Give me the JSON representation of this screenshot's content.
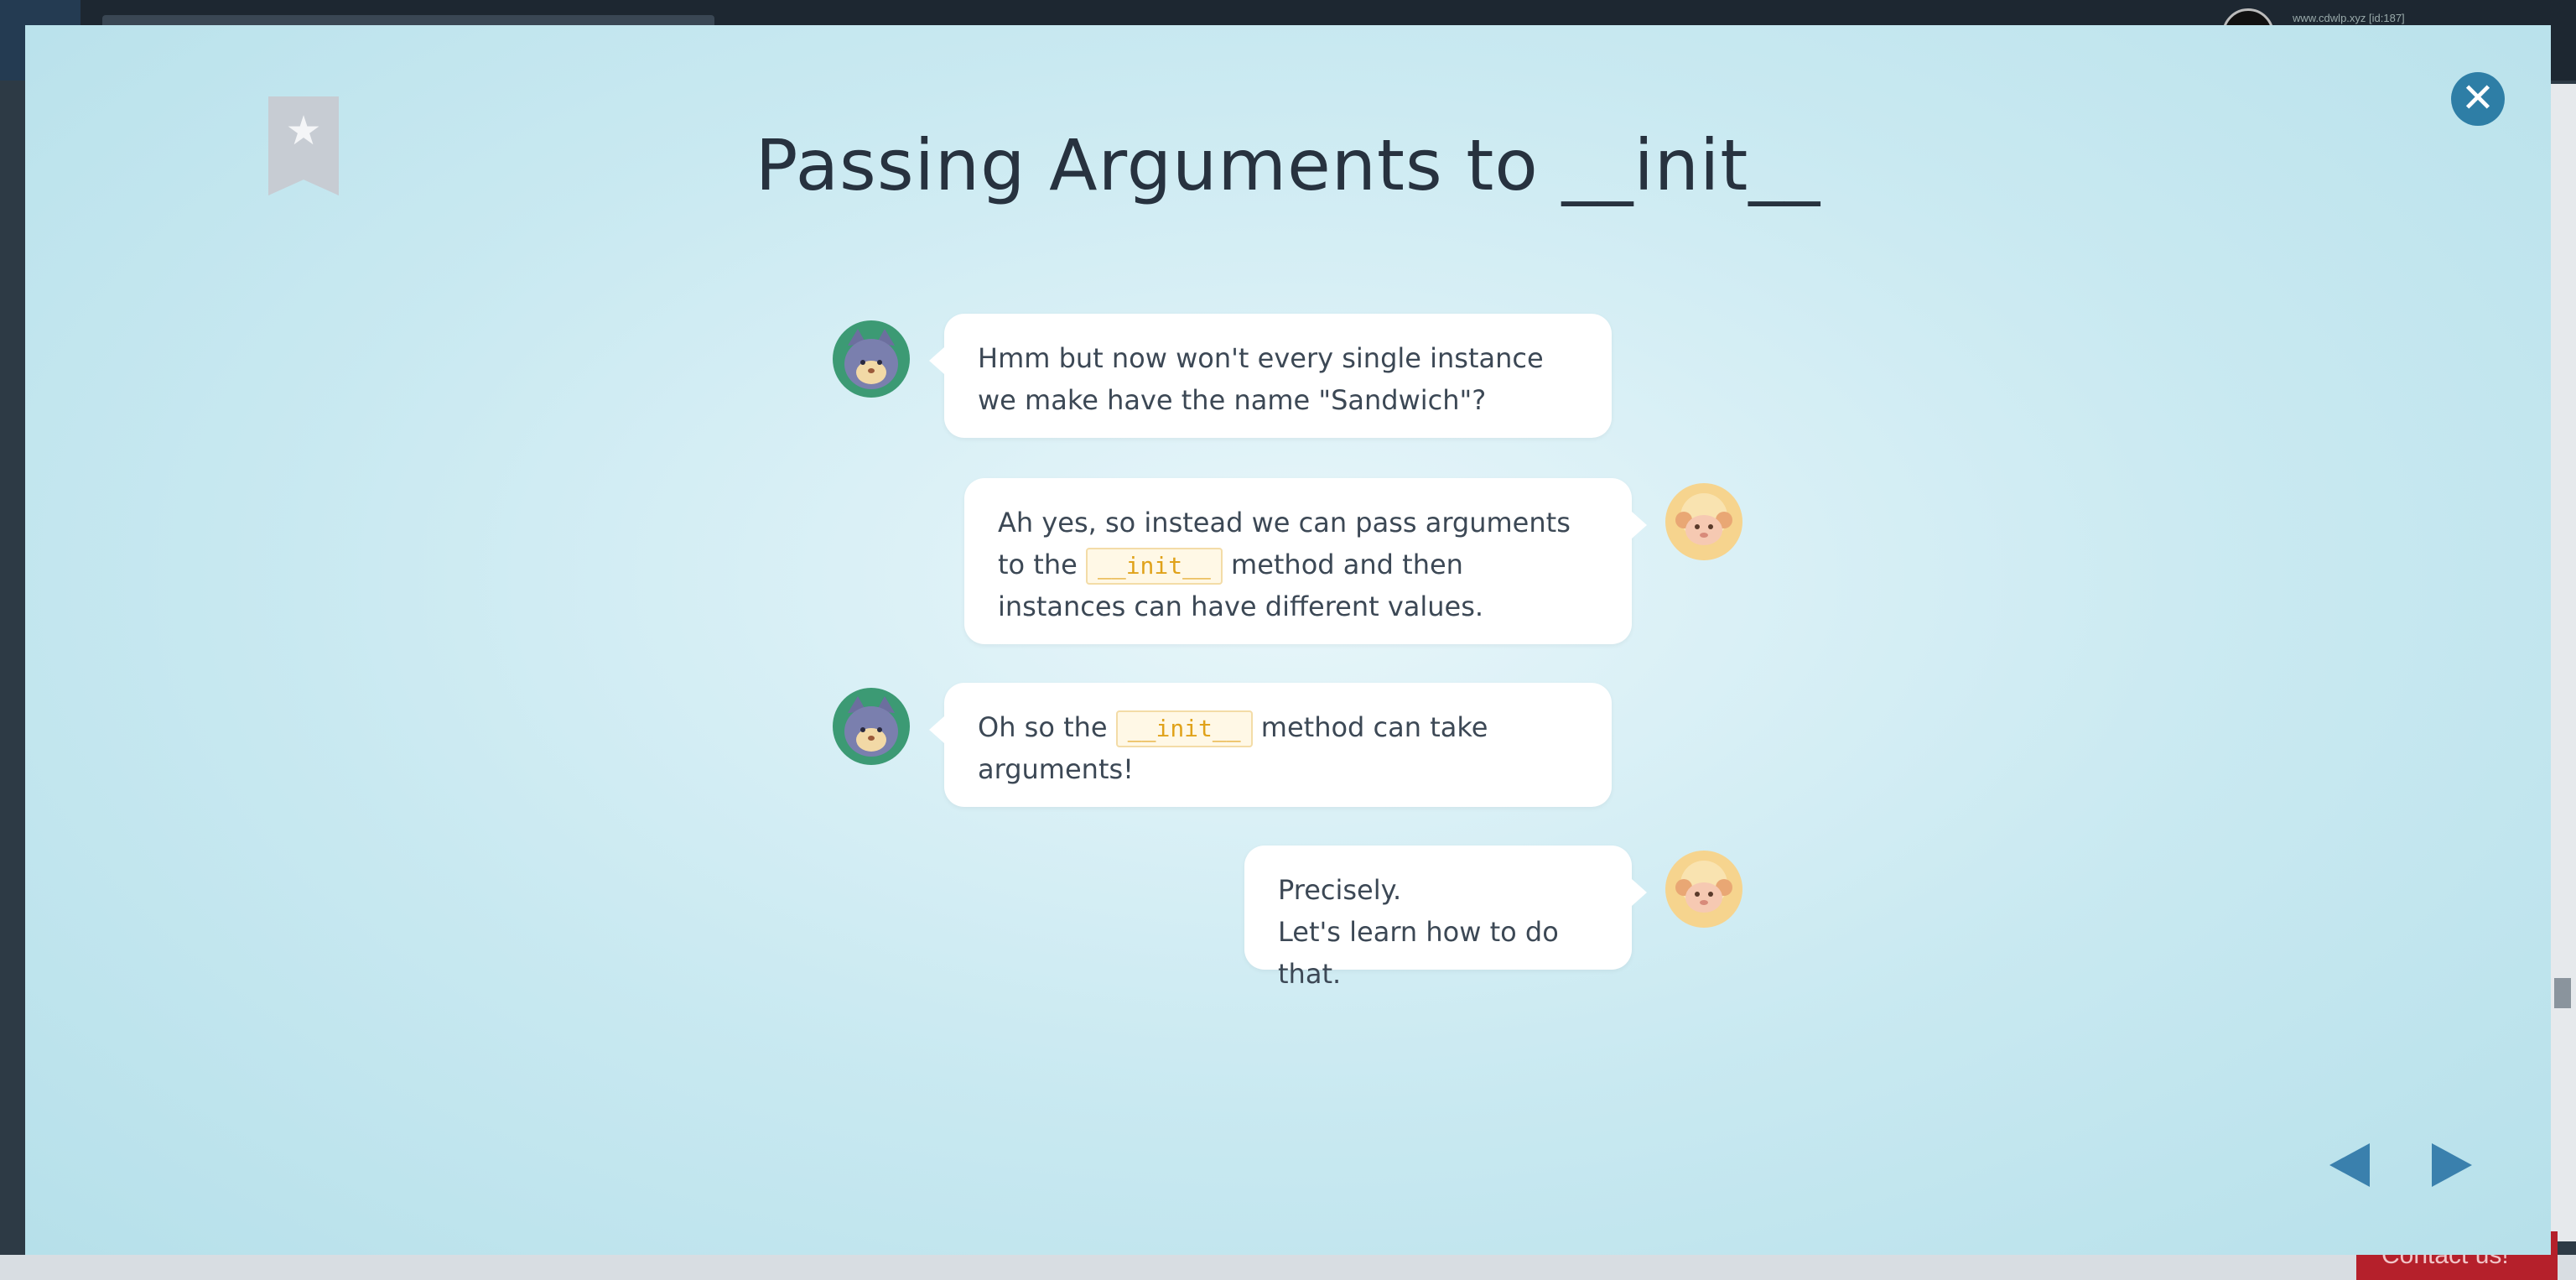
{
  "background": {
    "user_text": "www.cdwlp.xyz [id:187]",
    "contact_label": "Contact us!"
  },
  "lesson": {
    "title": "Passing Arguments to __init__",
    "bookmark_icon": "star",
    "close_icon": "close"
  },
  "messages": [
    {
      "speaker": "cat",
      "text": "Hmm but now won't every single instance we make have the name \"Sandwich\"?"
    },
    {
      "speaker": "sheep",
      "pre": "Ah yes, so instead we can pass arguments to the",
      "code": "__init__",
      "post": "method and then instances can have different values."
    },
    {
      "speaker": "cat",
      "pre": "Oh so the",
      "code": "__init__",
      "post": "method can take arguments!"
    },
    {
      "speaker": "sheep",
      "line1": "Precisely.",
      "line2": "Let's learn how to do that."
    }
  ],
  "navigation": {
    "prev_icon": "triangle-left",
    "next_icon": "triangle-right"
  },
  "colors": {
    "accent": "#3a80ad",
    "code_text": "#e0a21a",
    "cat_bg": "#3c9a74",
    "sheep_bg": "#f6d48e"
  }
}
